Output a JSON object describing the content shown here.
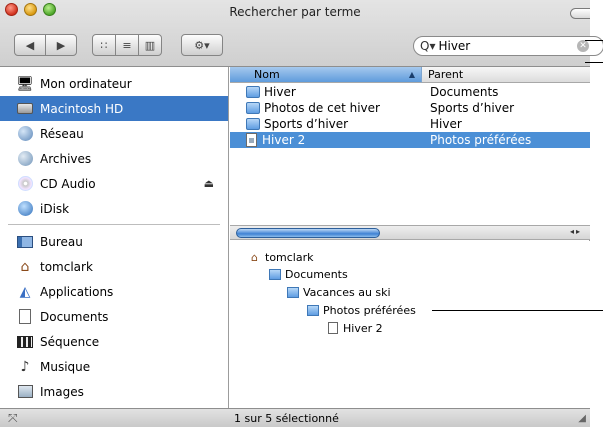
{
  "window": {
    "title": "Rechercher par terme"
  },
  "toolbar": {
    "back_icon": "◀",
    "forward_icon": "▶",
    "icon_view": "∷",
    "list_view": "≡",
    "column_view": "▥",
    "action_icon": "⚙▾"
  },
  "search": {
    "prefix": "Q▾",
    "value": "Hiver",
    "clear": "✕"
  },
  "sidebar": {
    "items": [
      {
        "label": "Mon ordinateur",
        "icon": "computer-icon"
      },
      {
        "label": "Macintosh HD",
        "icon": "hard-drive-icon",
        "selected": true
      },
      {
        "label": "Réseau",
        "icon": "network-icon"
      },
      {
        "label": "Archives",
        "icon": "server-icon"
      },
      {
        "label": "CD Audio",
        "icon": "cd-icon"
      },
      {
        "label": "iDisk",
        "icon": "idisk-icon"
      },
      {
        "label": "Bureau",
        "icon": "desktop-icon"
      },
      {
        "label": "tomclark",
        "icon": "home-icon"
      },
      {
        "label": "Applications",
        "icon": "applications-icon"
      },
      {
        "label": "Documents",
        "icon": "documents-icon"
      },
      {
        "label": "Séquence",
        "icon": "movies-icon"
      },
      {
        "label": "Musique",
        "icon": "music-icon"
      },
      {
        "label": "Images",
        "icon": "pictures-icon"
      }
    ],
    "eject": "⏏"
  },
  "list": {
    "headers": {
      "name": "Nom",
      "parent": "Parent"
    },
    "rows": [
      {
        "name": "Hiver",
        "parent": "Documents",
        "kind": "folder"
      },
      {
        "name": "Photos de cet hiver",
        "parent": "Sports d’hiver",
        "kind": "folder"
      },
      {
        "name": "Sports d’hiver",
        "parent": "Hiver",
        "kind": "folder"
      },
      {
        "name": "Hiver 2",
        "parent": "Photos préférées",
        "kind": "document",
        "selected": true
      }
    ]
  },
  "path": {
    "items": [
      "tomclark",
      "Documents",
      "Vacances au ski",
      "Photos préférées",
      "Hiver 2"
    ]
  },
  "status": {
    "text": "1 sur 5 sélectionné"
  },
  "colors": {
    "selection": "#3a78c5",
    "header_sorted": "#5f9bdc",
    "folder": "#5f9de2"
  }
}
